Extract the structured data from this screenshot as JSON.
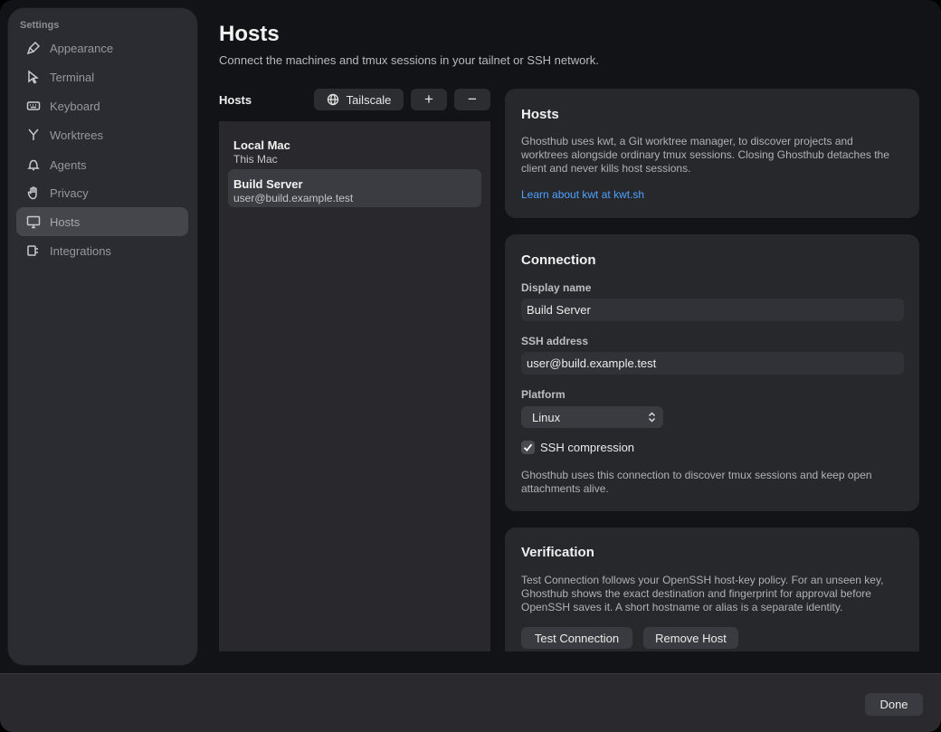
{
  "sidebar": {
    "header": "Settings",
    "items": [
      {
        "label": "Appearance",
        "icon": "brush-icon"
      },
      {
        "label": "Terminal",
        "icon": "cursor-icon"
      },
      {
        "label": "Keyboard",
        "icon": "keyboard-icon"
      },
      {
        "label": "Worktrees",
        "icon": "branch-icon"
      },
      {
        "label": "Agents",
        "icon": "bell-icon"
      },
      {
        "label": "Privacy",
        "icon": "hand-icon"
      },
      {
        "label": "Hosts",
        "icon": "display-icon",
        "active": true
      },
      {
        "label": "Integrations",
        "icon": "plug-icon"
      }
    ]
  },
  "page": {
    "title": "Hosts",
    "subtitle": "Connect the machines and tmux sessions in your tailnet or SSH network."
  },
  "host_list": {
    "label": "Hosts",
    "tailscale_label": "Tailscale",
    "add_label": "+",
    "remove_label": "−",
    "hosts": [
      {
        "name": "Local Mac",
        "sub": "This Mac"
      },
      {
        "name": "Build Server",
        "sub": "user@build.example.test",
        "selected": true
      }
    ]
  },
  "info_card": {
    "title": "Hosts",
    "text": "Ghosthub uses kwt, a Git worktree manager, to discover projects and worktrees alongside ordinary tmux sessions. Closing Ghosthub detaches the client and never kills host sessions.",
    "link": "Learn about kwt at kwt.sh"
  },
  "connection": {
    "title": "Connection",
    "display_name_label": "Display name",
    "display_name_value": "Build Server",
    "ssh_label": "SSH address",
    "ssh_value": "user@build.example.test",
    "platform_label": "Platform",
    "platform_value": "Linux",
    "compression_label": "SSH compression",
    "compression_checked": true,
    "note": "Ghosthub uses this connection to discover tmux sessions and keep open attachments alive."
  },
  "verification": {
    "title": "Verification",
    "text": "Test Connection follows your OpenSSH host-key policy. For an unseen key, Ghosthub shows the exact destination and fingerprint for approval before OpenSSH saves it. A short hostname or alias is a separate identity.",
    "test_label": "Test Connection",
    "remove_label": "Remove Host"
  },
  "footer": {
    "done_label": "Done"
  },
  "colors": {
    "accent_link": "#4ea1ff",
    "window_bg": "#121317",
    "card_bg": "#27282c"
  }
}
